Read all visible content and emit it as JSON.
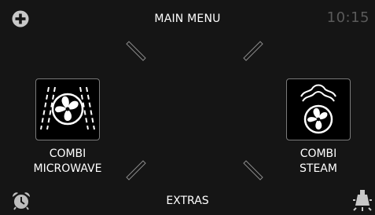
{
  "screen": {
    "title": "MAIN MENU",
    "clock": "10:15",
    "bottom": "EXTRAS"
  },
  "modes": [
    {
      "line1": "COMBI",
      "line2": "MICROWAVE",
      "icon": "combi-microwave-icon"
    },
    {
      "line1": "COMBI",
      "line2": "STEAM",
      "icon": "combi-steam-icon"
    }
  ],
  "icons": {
    "top_left": "plus-icon",
    "bottom_left": "alarm-clock-icon",
    "bottom_right": "lamp-icon"
  },
  "colors": {
    "background": "#151515",
    "text": "#ffffff",
    "clock": "#5a5a5a",
    "tile_border": "#7a7a7a",
    "divider": "#8a8a8a"
  }
}
